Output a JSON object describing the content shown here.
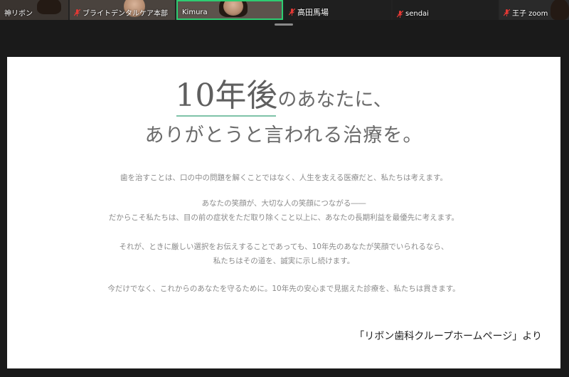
{
  "participants": [
    {
      "name": "神リボン",
      "muted": false
    },
    {
      "name": "ブライトデンタルケア本部",
      "muted": true
    },
    {
      "name": "Kimura",
      "muted": false,
      "active_speaker": true
    },
    {
      "name": "高田馬場",
      "muted": true
    },
    {
      "name": "sendai",
      "muted": true
    },
    {
      "name": "王子 zoom",
      "muted": true
    }
  ],
  "colors": {
    "active_speaker_border": "#2ecc71",
    "mute_icon": "#e53935",
    "underline_accent": "#7ec3a8"
  },
  "slide": {
    "headline_big": "10年後",
    "headline_rest": "のあなたに、",
    "subheadline": "ありがとうと言われる治療を。",
    "paragraphs": [
      [
        "歯を治すことは、口の中の問題を解くことではなく、人生を支える医療だと、私たちは考えます。"
      ],
      [
        "あなたの笑顔が、大切な人の笑顔につながる――",
        "だからこそ私たちは、目の前の症状をただ取り除くこと以上に、あなたの長期利益を最優先に考えます。"
      ],
      [
        "それが、ときに厳しい選択をお伝えすることであっても、10年先のあなたが笑顔でいられるなら、",
        "私たちはその道を、誠実に示し続けます。"
      ],
      [
        "今だけでなく、これからのあなたを守るために。10年先の安心まで見据えた診療を、私たちは貫きます。"
      ]
    ],
    "credit": "「リボン歯科クループホームページ」より"
  }
}
